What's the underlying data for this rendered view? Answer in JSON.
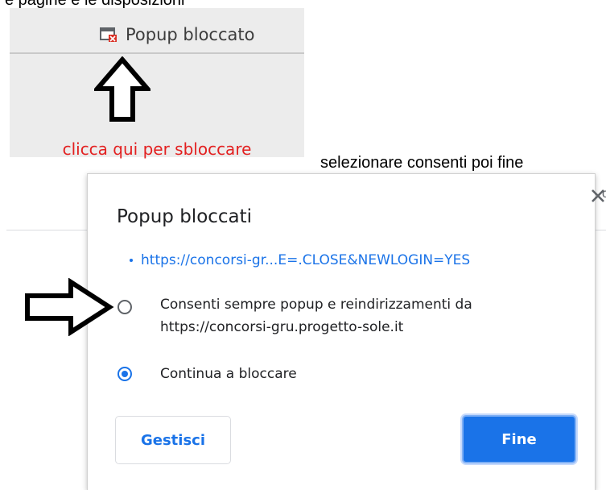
{
  "top_caption": "e pagine e le disposizioni",
  "omnibox": {
    "blocked_label": "Popup bloccato",
    "icon": "popup-blocked-icon"
  },
  "hint": {
    "text": "clicca qui per sbloccare",
    "color": "#e32020"
  },
  "instruction": "selezionare consenti poi fine",
  "dialog": {
    "title": "Popup bloccati",
    "blocked_url": "https://concorsi-gr...E=.CLOSE&NEWLOGIN=YES",
    "option_allow_line1": "Consenti sempre popup e reindirizzamenti da",
    "option_allow_line2": "https://concorsi-gru.progetto-sole.it",
    "option_block": "Continua a bloccare",
    "selected_option": "Continua a bloccare",
    "manage_button": "Gestisci",
    "done_button": "Fine",
    "accent": "#1a73e8"
  },
  "edge_fragment": "c"
}
